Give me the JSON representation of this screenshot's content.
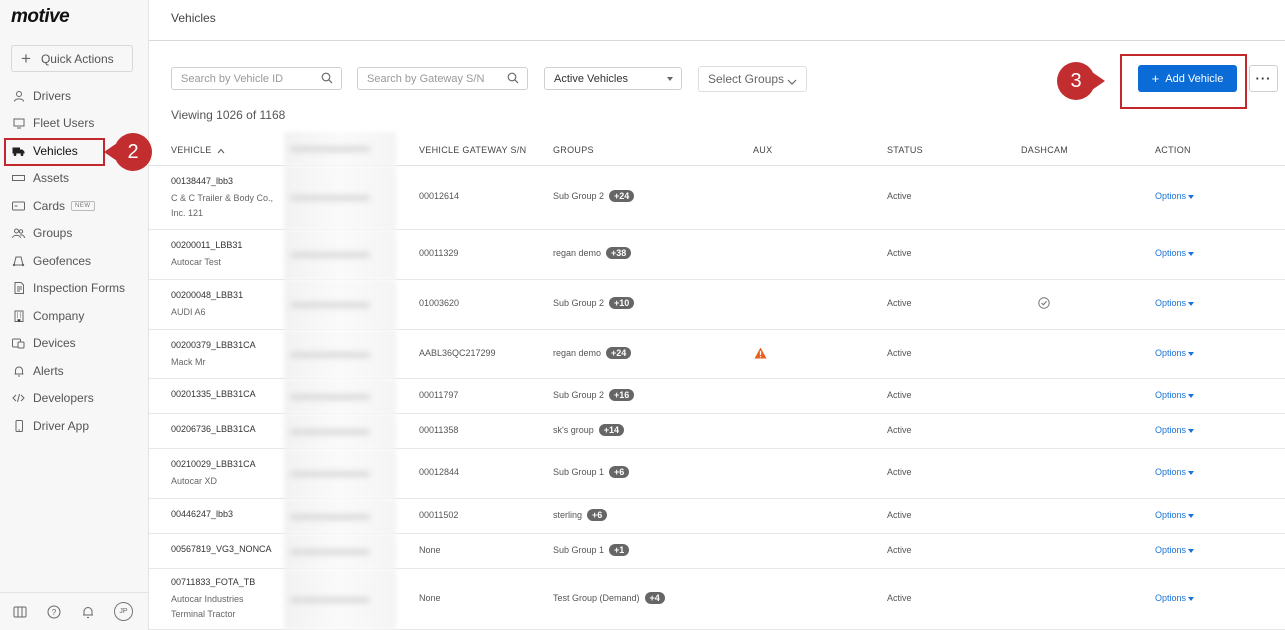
{
  "app": {
    "logo": "motive",
    "quick_actions": "Quick Actions"
  },
  "sidebar": {
    "items": [
      {
        "label": "Drivers",
        "icon": "person-icon"
      },
      {
        "label": "Fleet Users",
        "icon": "monitor-icon"
      },
      {
        "label": "Vehicles",
        "icon": "truck-icon",
        "active": true
      },
      {
        "label": "Assets",
        "icon": "trailer-icon"
      },
      {
        "label": "Cards",
        "icon": "card-icon",
        "badge": "NEW"
      },
      {
        "label": "Groups",
        "icon": "people-icon"
      },
      {
        "label": "Geofences",
        "icon": "geofence-icon"
      },
      {
        "label": "Inspection Forms",
        "icon": "document-icon"
      },
      {
        "label": "Company",
        "icon": "building-icon"
      },
      {
        "label": "Devices",
        "icon": "devices-icon"
      },
      {
        "label": "Alerts",
        "icon": "bell-icon"
      },
      {
        "label": "Developers",
        "icon": "code-icon"
      },
      {
        "label": "Driver App",
        "icon": "phone-icon"
      }
    ],
    "footer": {
      "avatar": "JP"
    }
  },
  "callouts": {
    "step2": "2",
    "step3": "3"
  },
  "header": {
    "title": "Vehicles"
  },
  "filters": {
    "vehicle_id_placeholder": "Search by Vehicle ID",
    "gateway_placeholder": "Search by Gateway S/N",
    "status_select": "Active Vehicles",
    "groups_select": "Select Groups"
  },
  "actions": {
    "add_vehicle": "Add Vehicle",
    "more": "···"
  },
  "viewing": "Viewing 1026 of 1168",
  "table": {
    "columns": {
      "vehicle": "VEHICLE",
      "gateway": "VEHICLE GATEWAY S/N",
      "groups": "GROUPS",
      "aux": "AUX",
      "status": "STATUS",
      "dashcam": "DASHCAM",
      "action": "ACTION"
    },
    "rows": [
      {
        "vehicle": "00138447_lbb3",
        "sub": [
          "C & C Trailer & Body Co.,",
          "Inc. 121"
        ],
        "gateway": "00012614",
        "group": "Sub Group 2",
        "more": "+24",
        "aux": "",
        "status": "Active",
        "dashcam": "",
        "action": "Options"
      },
      {
        "vehicle": "00200011_LBB31",
        "sub": [
          "Autocar Test"
        ],
        "gateway": "00011329",
        "group": "regan demo",
        "more": "+38",
        "aux": "",
        "status": "Active",
        "dashcam": "",
        "action": "Options"
      },
      {
        "vehicle": "00200048_LBB31",
        "sub": [
          "AUDI A6"
        ],
        "gateway": "01003620",
        "group": "Sub Group 2",
        "more": "+10",
        "aux": "",
        "status": "Active",
        "dashcam": "check-circle-icon",
        "action": "Options"
      },
      {
        "vehicle": "00200379_LBB31CA",
        "sub": [
          "Mack Mr"
        ],
        "gateway": "AABL36QC217299",
        "group": "regan demo",
        "more": "+24",
        "aux": "warning-icon",
        "status": "Active",
        "dashcam": "",
        "action": "Options"
      },
      {
        "vehicle": "00201335_LBB31CA",
        "sub": [],
        "gateway": "00011797",
        "group": "Sub Group 2",
        "more": "+16",
        "aux": "",
        "status": "Active",
        "dashcam": "",
        "action": "Options"
      },
      {
        "vehicle": "00206736_LBB31CA",
        "sub": [],
        "gateway": "00011358",
        "group": "sk's group",
        "more": "+14",
        "aux": "",
        "status": "Active",
        "dashcam": "",
        "action": "Options"
      },
      {
        "vehicle": "00210029_LBB31CA",
        "sub": [
          "Autocar XD"
        ],
        "gateway": "00012844",
        "group": "Sub Group 1",
        "more": "+6",
        "aux": "",
        "status": "Active",
        "dashcam": "",
        "action": "Options"
      },
      {
        "vehicle": "00446247_lbb3",
        "sub": [],
        "gateway": "00011502",
        "group": "sterling",
        "more": "+6",
        "aux": "",
        "status": "Active",
        "dashcam": "",
        "action": "Options"
      },
      {
        "vehicle": "00567819_VG3_NONCA",
        "sub": [],
        "gateway": "None",
        "group": "Sub Group 1",
        "more": "+1",
        "aux": "",
        "status": "Active",
        "dashcam": "",
        "action": "Options"
      },
      {
        "vehicle": "00711833_FOTA_TB",
        "sub": [
          "Autocar Industries",
          "Terminal Tractor"
        ],
        "gateway": "None",
        "group": "Test Group (Demand)",
        "more": "+4",
        "aux": "",
        "status": "Active",
        "dashcam": "",
        "action": "Options"
      }
    ]
  }
}
